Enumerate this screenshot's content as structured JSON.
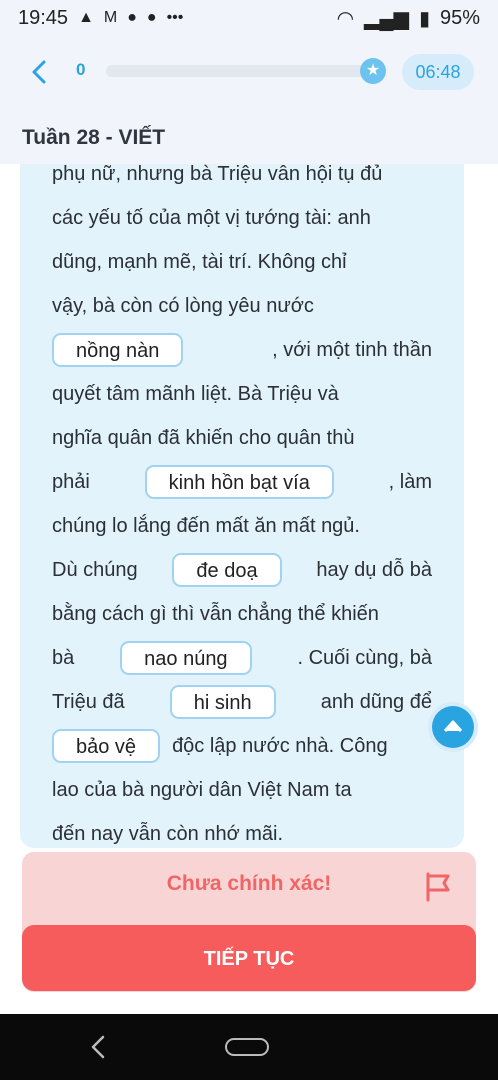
{
  "status_bar": {
    "time": "19:45",
    "left_icons": [
      "warning-icon",
      "gmail-icon",
      "chat-bubble-icon",
      "chat-bubble-icon",
      "more-dots-icon"
    ],
    "battery": "95%"
  },
  "header": {
    "progress_count": "0",
    "progress_fraction": 0,
    "timer": "06:48",
    "title": "Tuần 28 - VIẾT"
  },
  "passage": {
    "line_top": "phụ nữ, nhưng bà Triệu vẫn hội tụ đủ",
    "line1": "các yếu tố của một vị tướng tài: anh",
    "line2": "dũng, mạnh mẽ, tài trí. Không chỉ",
    "line3": "vậy, bà còn có lòng yêu nước",
    "chip1": "nồng nàn",
    "line4_after": ", với một tinh thần",
    "line5": "quyết tâm mãnh liệt. Bà Triệu và",
    "line6": "nghĩa quân đã khiến cho quân thù",
    "line7_before": "phải",
    "chip2": "kinh hồn bạt vía",
    "line7_after": ", làm",
    "line8": "chúng lo lắng đến mất ăn mất ngủ.",
    "line9_before": "Dù chúng",
    "chip3": "đe doạ",
    "line9_after": "hay dụ dỗ bà",
    "line10": "bằng cách gì thì vẫn chẳng thể khiến",
    "line11_before": "bà",
    "chip4": "nao núng",
    "line11_after": ". Cuối cùng, bà",
    "line12_before": "Triệu đã",
    "chip5": "hi sinh",
    "line12_after": "anh dũng để",
    "chip6": "bảo vệ",
    "line13_after": "độc lập nước nhà. Công",
    "line14": "lao của bà người dân Việt Nam ta",
    "line15": "đến nay vẫn còn nhớ mãi."
  },
  "feedback": {
    "message": "Chưa chính xác!",
    "icon": "flag-icon",
    "continue_label": "TIẾP TỤC"
  },
  "colors": {
    "accent": "#2aa4e0",
    "card_bg": "#e3f3fb",
    "error_bg": "#f8d4d4",
    "error_text": "#f06565",
    "button": "#f65c5c"
  }
}
